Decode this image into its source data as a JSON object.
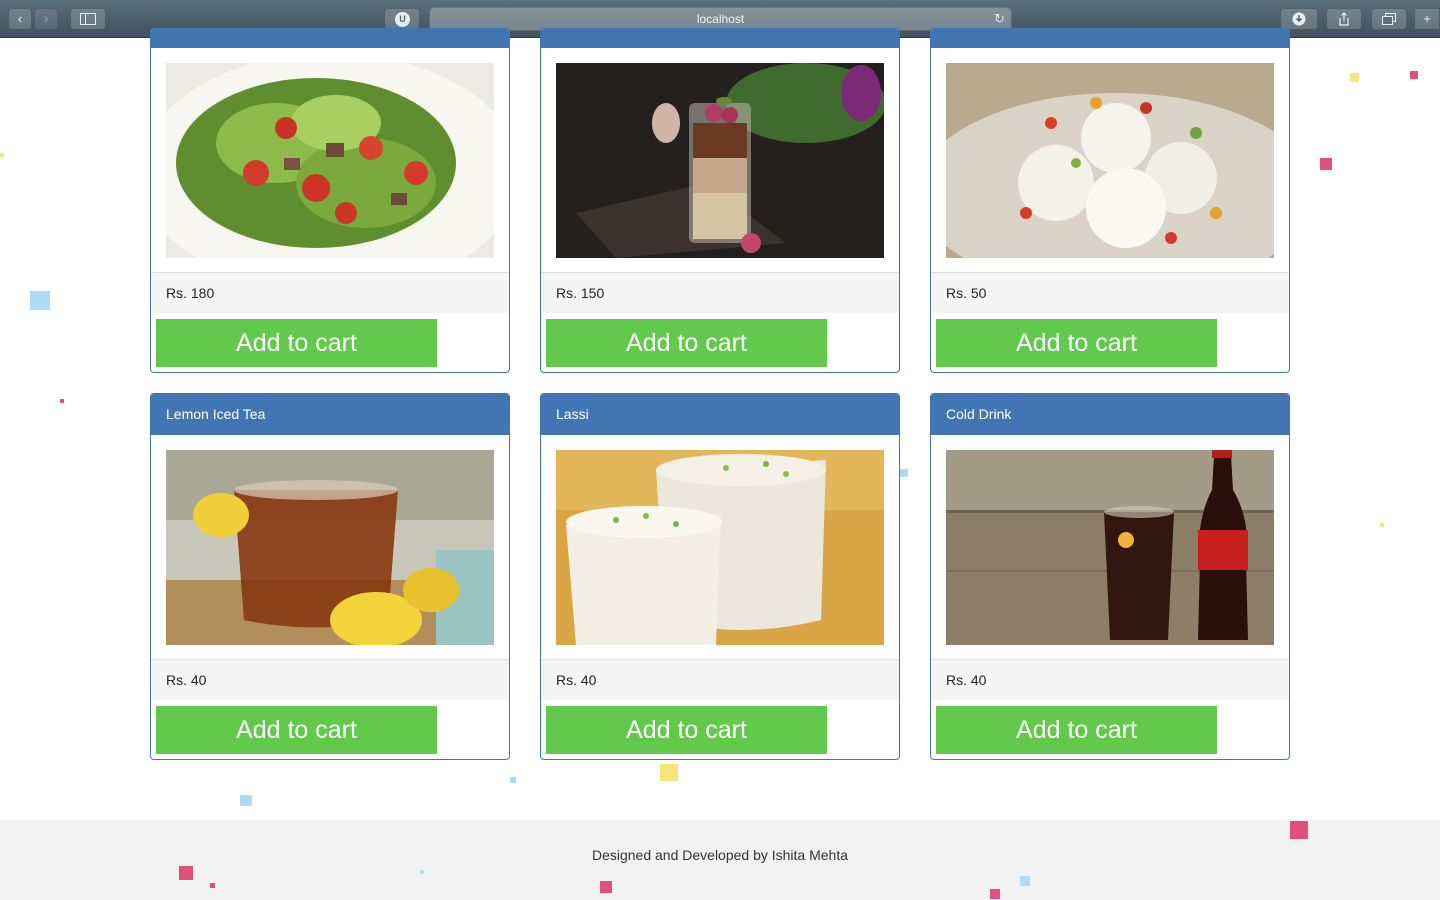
{
  "browser": {
    "url": "localhost"
  },
  "products": [
    {
      "name": "",
      "price": "Rs. 180",
      "button": "Add to cart",
      "photo": "salad"
    },
    {
      "name": "",
      "price": "Rs. 150",
      "button": "Add to cart",
      "photo": "chocolate-mousse"
    },
    {
      "name": "",
      "price": "Rs. 50",
      "button": "Add to cart",
      "photo": "rasgulla"
    },
    {
      "name": "Lemon Iced Tea",
      "price": "Rs. 40",
      "button": "Add to cart",
      "photo": "iced-tea"
    },
    {
      "name": "Lassi",
      "price": "Rs. 40",
      "button": "Add to cart",
      "photo": "lassi"
    },
    {
      "name": "Cold Drink",
      "price": "Rs. 40",
      "button": "Add to cart",
      "photo": "cola"
    }
  ],
  "footer": {
    "credit": "Designed and Developed by Ishita Mehta"
  },
  "colors": {
    "card_header": "#4276b3",
    "cart_button": "#62c94c",
    "price_row": "#f5f5f5",
    "footer_bg": "#f2f2f2"
  }
}
